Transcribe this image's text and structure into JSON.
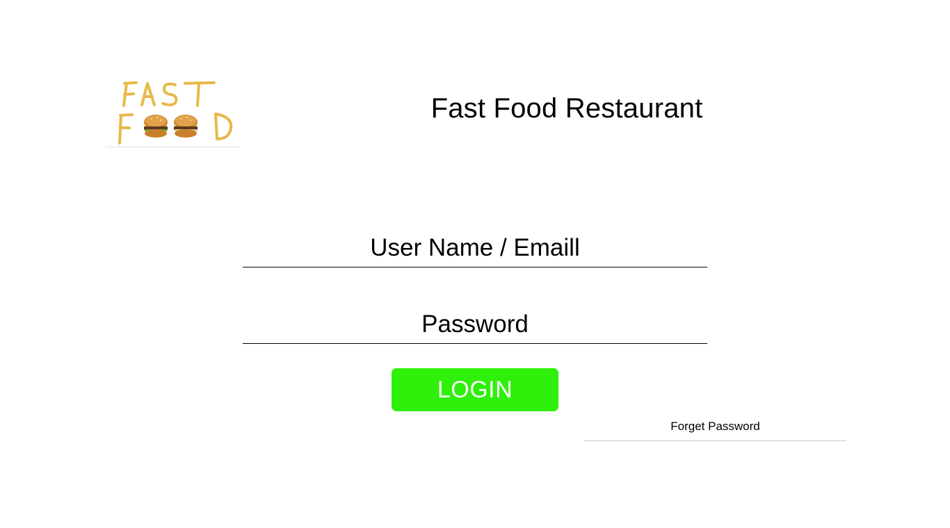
{
  "header": {
    "title": "Fast Food Restaurant",
    "logo": {
      "icon": "fast-food-logo",
      "line1": "FAST",
      "line2": "FOOD"
    }
  },
  "login_form": {
    "username": {
      "placeholder": "User Name / Emaill",
      "value": ""
    },
    "password": {
      "placeholder": "Password",
      "value": ""
    },
    "login_label": "LOGIN",
    "forget_password_label": "Forget Password"
  },
  "colors": {
    "login_button": "#2ff00b",
    "login_text": "#ffffff",
    "logo_fries": "#e8b84a",
    "burger_bun": "#c9802a"
  }
}
